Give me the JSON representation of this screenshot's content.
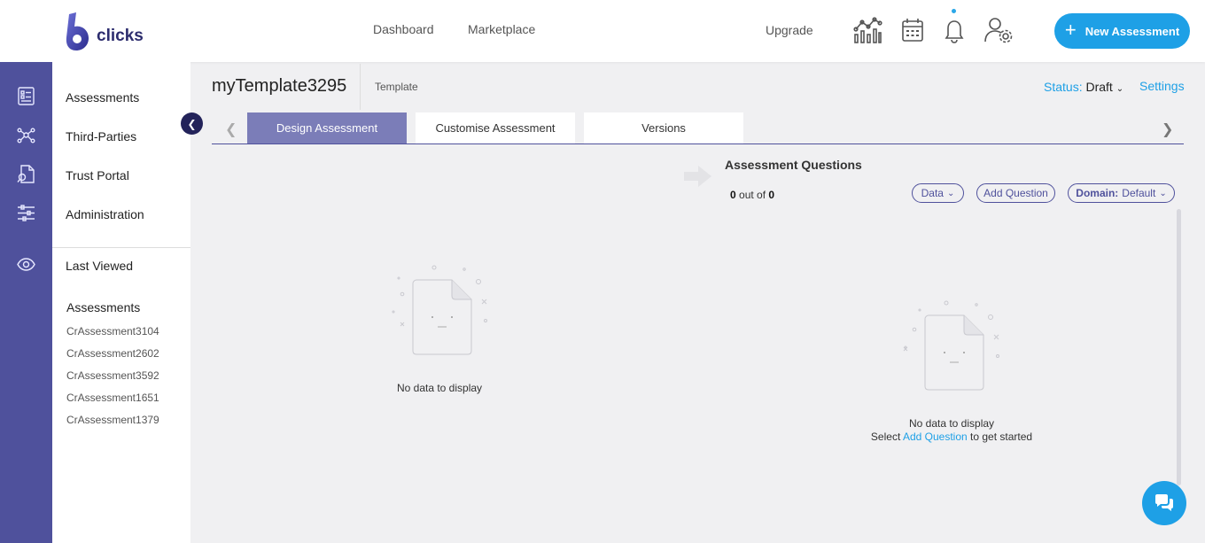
{
  "header": {
    "brand": "clicks",
    "nav": [
      "Dashboard",
      "Marketplace"
    ],
    "upgrade": "Upgrade",
    "icons": [
      "analytics-chart-icon",
      "calendar-icon",
      "bell-icon",
      "user-settings-icon"
    ],
    "new_button": "New Assessment"
  },
  "sidebar": {
    "rail_icons": [
      "assessments-icon",
      "network-icon",
      "document-search-icon",
      "sliders-icon",
      "eye-icon"
    ],
    "items": [
      "Assessments",
      "Third-Parties",
      "Trust Portal",
      "Administration"
    ],
    "last_viewed": "Last Viewed",
    "recent_section": "Assessments",
    "recent_items": [
      "CrAssessment3104",
      "CrAssessment2602",
      "CrAssessment3592",
      "CrAssessment1651",
      "CrAssessment1379"
    ]
  },
  "page": {
    "title": "myTemplate3295",
    "subtitle": "Template",
    "status_label": "Status:",
    "status_value": "Draft",
    "settings": "Settings"
  },
  "tabs": [
    "Design Assessment",
    "Customise Assessment",
    "Versions"
  ],
  "questions": {
    "title": "Assessment Questions",
    "count_current": "0",
    "count_mid": "out of",
    "count_total": "0",
    "filters": {
      "data": "Data",
      "add_question": "Add Question",
      "domain_label": "Domain:",
      "domain_value": "Default"
    },
    "empty_text": "No data to display",
    "hint_prefix": "Select",
    "hint_link": "Add Question",
    "hint_suffix": "to get started"
  },
  "left_panel": {
    "empty_text": "No data to display"
  },
  "colors": {
    "accent": "#1ea0e6",
    "rail": "#4f519c",
    "tab_active": "#7b7db8",
    "collapse": "#23235a"
  }
}
